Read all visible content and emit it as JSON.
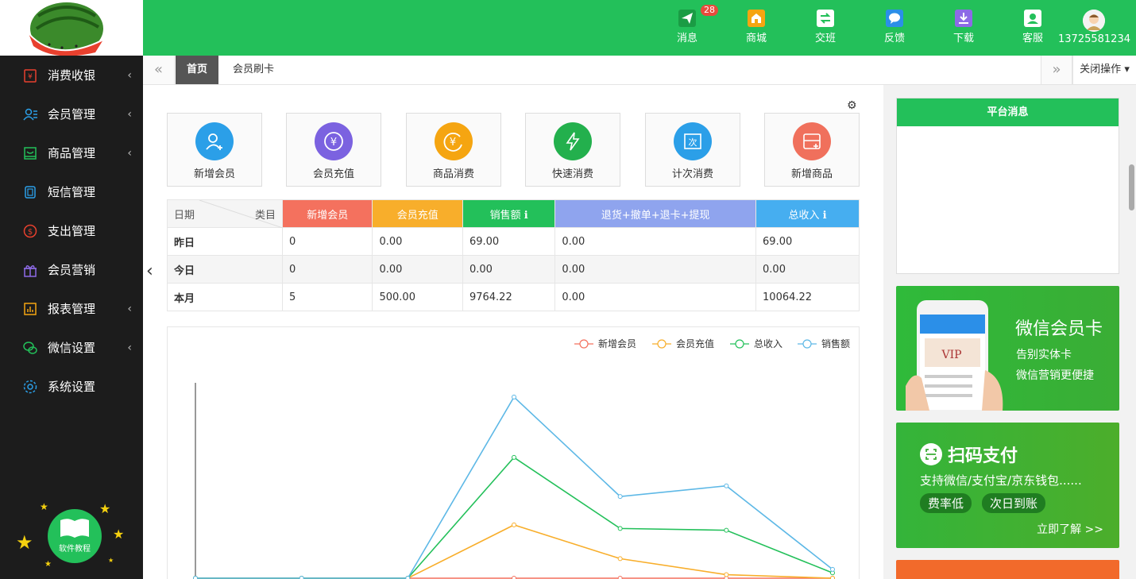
{
  "header": {
    "items": [
      {
        "label": "消息",
        "icon": "paper-plane-icon",
        "badge": "28"
      },
      {
        "label": "商城",
        "icon": "store-icon"
      },
      {
        "label": "交班",
        "icon": "shift-swap-icon"
      },
      {
        "label": "反馈",
        "icon": "chat-bubble-icon"
      },
      {
        "label": "下载",
        "icon": "download-icon"
      },
      {
        "label": "客服",
        "icon": "customer-service-icon"
      }
    ],
    "user_phone": "13725581234"
  },
  "sidebar": {
    "items": [
      {
        "label": "消费收银",
        "icon": "cash-register-icon",
        "has_arrow": true
      },
      {
        "label": "会员管理",
        "icon": "users-icon",
        "has_arrow": true
      },
      {
        "label": "商品管理",
        "icon": "goods-icon",
        "has_arrow": true
      },
      {
        "label": "短信管理",
        "icon": "sms-icon",
        "has_arrow": false
      },
      {
        "label": "支出管理",
        "icon": "expense-icon",
        "has_arrow": false
      },
      {
        "label": "会员营销",
        "icon": "gift-icon",
        "has_arrow": false
      },
      {
        "label": "报表管理",
        "icon": "report-icon",
        "has_arrow": true
      },
      {
        "label": "微信设置",
        "icon": "wechat-icon",
        "has_arrow": true
      },
      {
        "label": "系统设置",
        "icon": "settings-icon",
        "has_arrow": false
      }
    ],
    "tutorial_label": "软件教程"
  },
  "tabs": {
    "items": [
      {
        "label": "首页",
        "active": true
      },
      {
        "label": "会员刷卡",
        "active": false
      }
    ],
    "close_ops": "关闭操作"
  },
  "quick_actions": [
    {
      "label": "新增会员",
      "icon": "add-member-icon",
      "color": "#2b9fe8"
    },
    {
      "label": "会员充值",
      "icon": "recharge-icon",
      "color": "#7b62e0"
    },
    {
      "label": "商品消费",
      "icon": "goods-consume-icon",
      "color": "#f5a511"
    },
    {
      "label": "快速消费",
      "icon": "lightning-icon",
      "color": "#23b04d"
    },
    {
      "label": "计次消费",
      "icon": "count-consume-icon",
      "color": "#2b9fe8"
    },
    {
      "label": "新增商品",
      "icon": "add-goods-icon",
      "color": "#f0705c"
    }
  ],
  "stats": {
    "corner_left": "日期",
    "corner_right": "类目",
    "columns": [
      {
        "label": "新增会员",
        "color": "#f4715e"
      },
      {
        "label": "会员充值",
        "color": "#f8ae2b"
      },
      {
        "label": "销售额 ℹ",
        "color": "#23c05a"
      },
      {
        "label": "退货+撤单+退卡+提现",
        "color": "#8fa4ee"
      },
      {
        "label": "总收入 ℹ",
        "color": "#46aef0"
      }
    ],
    "rows": [
      {
        "label": "昨日",
        "values": [
          "0",
          "0.00",
          "69.00",
          "0.00",
          "69.00"
        ]
      },
      {
        "label": "今日",
        "values": [
          "0",
          "0.00",
          "0.00",
          "0.00",
          "0.00"
        ]
      },
      {
        "label": "本月",
        "values": [
          "5",
          "500.00",
          "9764.22",
          "0.00",
          "10064.22"
        ]
      }
    ]
  },
  "chart_data": {
    "type": "line",
    "legend_position": "top-right",
    "series": [
      {
        "name": "新增会员",
        "color": "#f4715e",
        "values": [
          0,
          0,
          0,
          0,
          0,
          0,
          0
        ]
      },
      {
        "name": "会员充值",
        "color": "#f8ae2b",
        "values": [
          0,
          0,
          0,
          300,
          110,
          20,
          0
        ]
      },
      {
        "name": "总收入",
        "color": "#23c05a",
        "values": [
          0,
          0,
          0,
          680,
          280,
          270,
          30
        ]
      },
      {
        "name": "销售额",
        "color": "#5db8e6",
        "values": [
          0,
          0,
          0,
          1020,
          460,
          520,
          50
        ]
      }
    ],
    "y_max": 1100
  },
  "right": {
    "message_title": "平台消息",
    "promo1": {
      "title": "微信会员卡",
      "line1": "告别实体卡",
      "line2": "微信营销更便捷"
    },
    "promo2": {
      "title": "扫码支付",
      "subtitle": "支持微信/支付宝/京东钱包......",
      "tag1": "费率低",
      "tag2": "次日到账",
      "link": "立即了解 >>"
    }
  },
  "colors": {
    "brand": "#23c05a",
    "sidebar": "#1c1c1c"
  }
}
